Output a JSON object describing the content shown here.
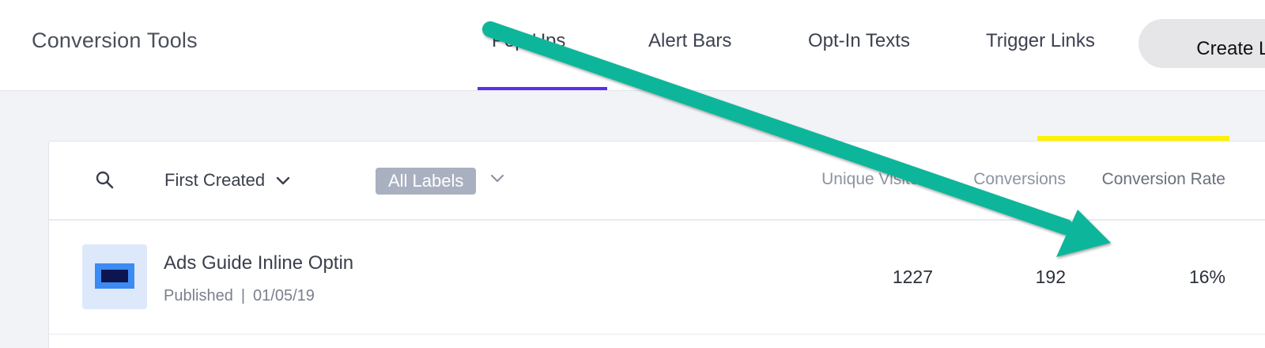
{
  "app": {
    "title": "Conversion Tools"
  },
  "nav": {
    "tabs": [
      {
        "label": "Pop-Ups",
        "active": true
      },
      {
        "label": "Alert Bars"
      },
      {
        "label": "Opt-In Texts"
      },
      {
        "label": "Trigger Links"
      }
    ],
    "create_button": "Create Le"
  },
  "filters": {
    "sort": "First Created",
    "labels": "All Labels"
  },
  "columns": {
    "visitors": "Unique Visitors",
    "conversions": "Conversions",
    "rate": "Conversion Rate"
  },
  "rows": [
    {
      "title": "Ads Guide Inline Optin",
      "status": "Published",
      "separator": "|",
      "date": "01/05/19",
      "visitors": "1227",
      "conversions": "192",
      "rate": "16%"
    }
  ],
  "colors": {
    "accent": "#5b2ef0",
    "highlight": "#fff200",
    "annotation_arrow": "#0fb69a",
    "label_badge": "#a9b0c0"
  },
  "icons": [
    "search-icon",
    "chevron-down-icon",
    "annotation-arrow-icon"
  ]
}
